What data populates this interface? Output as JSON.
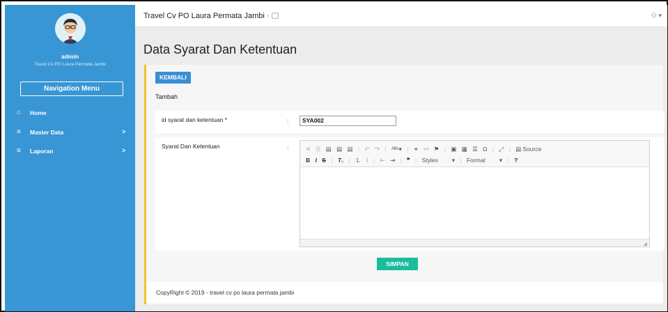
{
  "sidebar": {
    "admin_name": "admin",
    "company": "Travel Cv PO Laura Permata Jambi",
    "nav_menu_label": "Navigation Menu",
    "items": [
      {
        "label": "Home",
        "icon": "home-icon",
        "chevron": ""
      },
      {
        "label": "Master Data",
        "icon": "list-icon",
        "chevron": ">"
      },
      {
        "label": "Laporan",
        "icon": "list-icon",
        "chevron": ">"
      }
    ]
  },
  "topbar": {
    "title": "Travel Cv PO Laura Permata Jambi",
    "monitor_icon": "monitor-icon",
    "user_icon": "user-icon"
  },
  "page": {
    "title": "Data Syarat Dan Ketentuan",
    "back_button": "KEMBALI",
    "subtitle": "Tambah",
    "field_id_label": "id syarat dan ketentuan *",
    "field_id_value": "SYA002",
    "field_terms_label": "Syarat Dan Ketentuan",
    "colon": ":",
    "save_button": "SIMPAN"
  },
  "editor": {
    "source_label": "Source",
    "styles_label": "Styles",
    "format_label": "Format"
  },
  "footer": {
    "text": "CopyRight © 2019 - travel cv po laura permata jambi"
  },
  "colors": {
    "sidebar": "#3896d4",
    "accent_yellow": "#f2c230",
    "save_green": "#1bbc9b",
    "back_blue": "#3a8fd4"
  }
}
